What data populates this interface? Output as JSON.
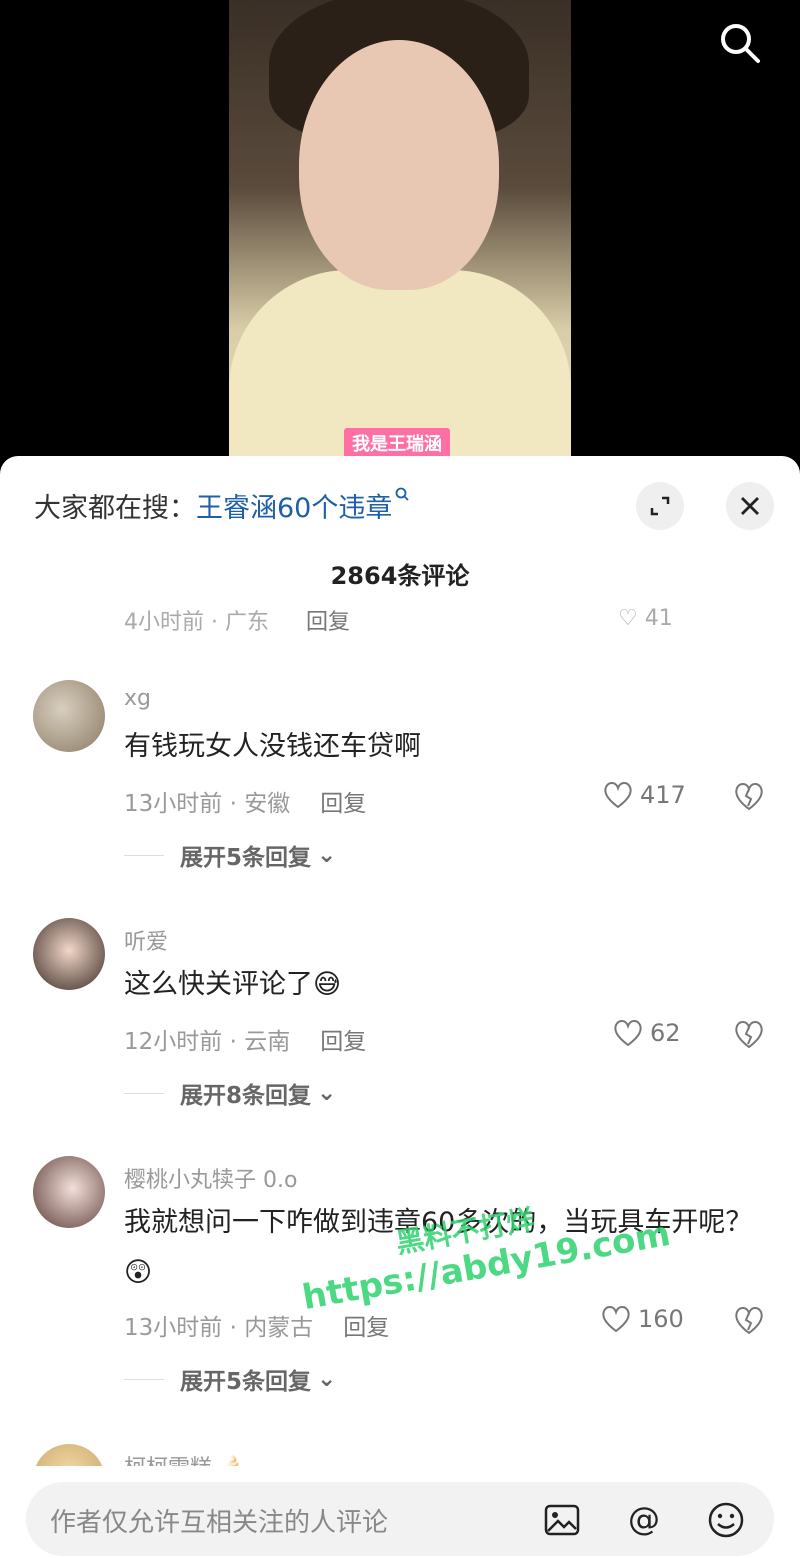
{
  "video": {
    "caption": "我是王瑞涵"
  },
  "sheet": {
    "trend_prefix": "大家都在搜：",
    "trend_keyword": "王睿涵60个违章",
    "comment_count": "2864条评论",
    "partial_meta": "4小时前 · 广东",
    "partial_reply": "回复",
    "partial_likes": "41"
  },
  "comments": [
    {
      "username": "xg",
      "text": "有钱玩女人没钱还车贷啊",
      "time_location": "13小时前 · 安徽",
      "reply_label": "回复",
      "likes": "417",
      "expand": "展开5条回复"
    },
    {
      "username": "听爱",
      "text": "这么快关评论了😅",
      "time_location": "12小时前 · 云南",
      "reply_label": "回复",
      "likes": "62",
      "expand": "展开8条回复"
    },
    {
      "username": "樱桃小丸犊子 0.o",
      "text": "我就想问一下咋做到违章60多次的，当玩具车开呢？😲",
      "time_location": "13小时前 · 内蒙古",
      "reply_label": "回复",
      "likes": "160",
      "expand": "展开5条回复"
    }
  ],
  "next_comment": {
    "username": "柯柯雪糕 🍦"
  },
  "input_bar": {
    "placeholder": "作者仅允许互相关注的人评论"
  },
  "watermark": {
    "line1": "黑料不打烊",
    "line2": "https://abdy19.com"
  },
  "colors": {
    "keyword": "#1f5fa8",
    "caption_bg": "#ff6fa3",
    "watermark": "#2fd36e"
  }
}
